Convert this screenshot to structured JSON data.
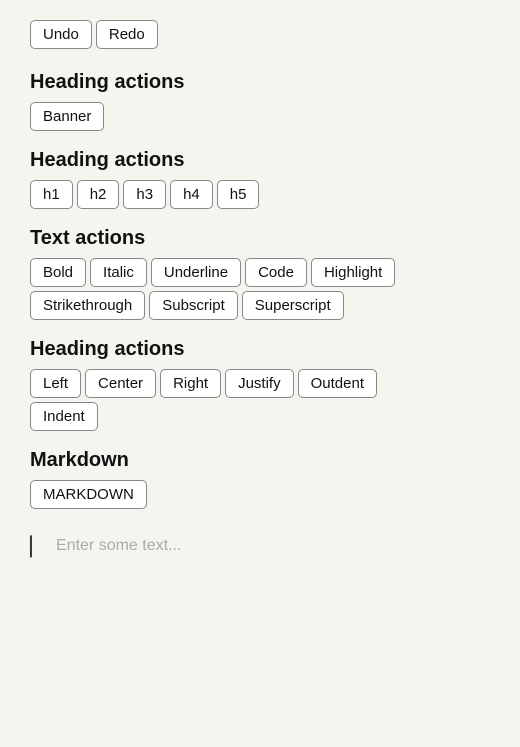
{
  "topButtons": [
    "Undo",
    "Redo"
  ],
  "sections": [
    {
      "id": "heading-actions-1",
      "title": "Heading actions",
      "rows": [
        [
          "Banner"
        ]
      ]
    },
    {
      "id": "heading-actions-2",
      "title": "Heading actions",
      "rows": [
        [
          "h1",
          "h2",
          "h3",
          "h4",
          "h5"
        ]
      ]
    },
    {
      "id": "text-actions",
      "title": "Text actions",
      "rows": [
        [
          "Bold",
          "Italic",
          "Underline",
          "Code",
          "Highlight"
        ],
        [
          "Strikethrough",
          "Subscript",
          "Superscript"
        ]
      ]
    },
    {
      "id": "heading-actions-3",
      "title": "Heading actions",
      "rows": [
        [
          "Left",
          "Center",
          "Right",
          "Justify",
          "Outdent"
        ],
        [
          "Indent"
        ]
      ]
    },
    {
      "id": "markdown",
      "title": "Markdown",
      "rows": [
        [
          "MARKDOWN"
        ]
      ]
    }
  ],
  "textInput": {
    "placeholder": "Enter some text..."
  }
}
